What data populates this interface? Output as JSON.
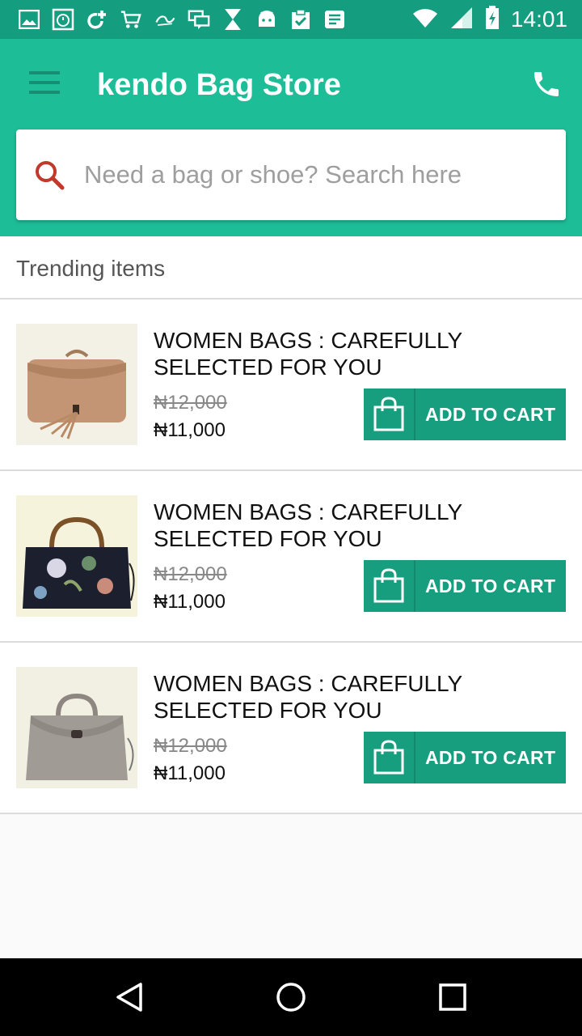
{
  "status_bar": {
    "time": "14:01",
    "icons": [
      "gallery-icon",
      "stopwatch-icon",
      "refresh-plus-icon",
      "shopping-cart-icon",
      "alibaba-icon",
      "chat-icon",
      "hourglass-icon",
      "android-icon",
      "clipboard-check-icon",
      "message-icon"
    ],
    "right_icons": [
      "wifi-icon",
      "signal-icon",
      "battery-charging-icon"
    ]
  },
  "app_bar": {
    "title": "kendo Bag Store",
    "menu_icon": "menu-icon",
    "phone_icon": "phone-icon",
    "color": "#1dbd98"
  },
  "search": {
    "placeholder": "Need a bag or shoe? Search here",
    "icon": "search-icon",
    "icon_color": "#c0392b"
  },
  "section": {
    "title": "Trending items"
  },
  "items": [
    {
      "title": "WOMEN BAGS : CAREFULLY SELECTED FOR YOU",
      "old_price": "₦12,000",
      "new_price": "₦11,000",
      "button_label": "ADD TO CART",
      "image": "tan leather tassel bag"
    },
    {
      "title": "WOMEN BAGS : CAREFULLY SELECTED FOR YOU",
      "old_price": "₦12,000",
      "new_price": "₦11,000",
      "button_label": "ADD TO CART",
      "image": "floral black handbag"
    },
    {
      "title": "WOMEN BAGS : CAREFULLY SELECTED FOR YOU",
      "old_price": "₦12,000",
      "new_price": "₦11,000",
      "button_label": "ADD TO CART",
      "image": "grey leather handbag"
    }
  ],
  "nav_bar": {
    "buttons": [
      "back-icon",
      "home-icon",
      "recents-icon"
    ]
  },
  "colors": {
    "accent": "#179e7f",
    "status_bar": "#149e7f"
  }
}
